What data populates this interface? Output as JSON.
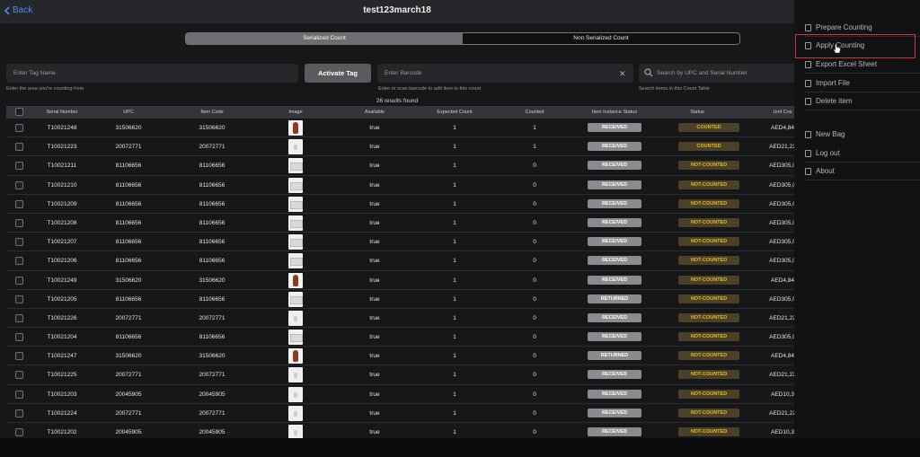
{
  "header": {
    "back_label": "Back",
    "title": "test123march18"
  },
  "segment": {
    "serialized": "Serialized Count",
    "non_serialized": "Non Serialized Count"
  },
  "inputs": {
    "tag_placeholder": "Enter Tag Name",
    "tag_hint": "Enter the area you're counting from.",
    "activate_label": "Activate Tag",
    "barcode_placeholder": "Enter Barcode",
    "barcode_hint": "Enter or scan barcode to add item to this count",
    "search_placeholder": "Search by UPC and Serial Number",
    "search_hint": "Search items in this Count Table"
  },
  "results_label": "26 results found",
  "table": {
    "headers": [
      "Serial Number",
      "UPC",
      "Item Code",
      "Image",
      "Available",
      "Expected Count",
      "Counted",
      "Item Instance Status",
      "Status",
      "Unit Cos"
    ],
    "rows": [
      {
        "serial": "T10021248",
        "upc": "31506620",
        "code": "31506620",
        "img": "vase",
        "available": "true",
        "expected": "1",
        "counted": "1",
        "instance": "RECEIVED",
        "status": "COUNTED",
        "cost": "AED4,84"
      },
      {
        "serial": "T10021223",
        "upc": "20072771",
        "code": "20072771",
        "img": "white",
        "available": "true",
        "expected": "1",
        "counted": "1",
        "instance": "RECEIVED",
        "status": "COUNTED",
        "cost": "AED21,22"
      },
      {
        "serial": "T10021211",
        "upc": "81106656",
        "code": "81106656",
        "img": "box",
        "available": "true",
        "expected": "1",
        "counted": "0",
        "instance": "RECEIVED",
        "status": "NOT-COUNTED",
        "cost": "AED305,0"
      },
      {
        "serial": "T10021210",
        "upc": "81106656",
        "code": "81106656",
        "img": "box",
        "available": "true",
        "expected": "1",
        "counted": "0",
        "instance": "RECEIVED",
        "status": "NOT-COUNTED",
        "cost": "AED305,0"
      },
      {
        "serial": "T10021209",
        "upc": "81106656",
        "code": "81106656",
        "img": "box",
        "available": "true",
        "expected": "1",
        "counted": "0",
        "instance": "RECEIVED",
        "status": "NOT-COUNTED",
        "cost": "AED305,0"
      },
      {
        "serial": "T10021208",
        "upc": "81106656",
        "code": "81106656",
        "img": "box",
        "available": "true",
        "expected": "1",
        "counted": "0",
        "instance": "RECEIVED",
        "status": "NOT-COUNTED",
        "cost": "AED305,0"
      },
      {
        "serial": "T10021207",
        "upc": "81106656",
        "code": "81106656",
        "img": "box",
        "available": "true",
        "expected": "1",
        "counted": "0",
        "instance": "RECEIVED",
        "status": "NOT-COUNTED",
        "cost": "AED305,0"
      },
      {
        "serial": "T10021206",
        "upc": "81106656",
        "code": "81106656",
        "img": "box",
        "available": "true",
        "expected": "1",
        "counted": "0",
        "instance": "RECEIVED",
        "status": "NOT-COUNTED",
        "cost": "AED305,0"
      },
      {
        "serial": "T10021249",
        "upc": "31506620",
        "code": "31506620",
        "img": "vase",
        "available": "true",
        "expected": "1",
        "counted": "0",
        "instance": "RECEIVED",
        "status": "NOT-COUNTED",
        "cost": "AED4,84"
      },
      {
        "serial": "T10021205",
        "upc": "81106656",
        "code": "81106656",
        "img": "box",
        "available": "true",
        "expected": "1",
        "counted": "0",
        "instance": "RETURNED",
        "status": "NOT-COUNTED",
        "cost": "AED305,0"
      },
      {
        "serial": "T10021226",
        "upc": "20072771",
        "code": "20072771",
        "img": "white",
        "available": "true",
        "expected": "1",
        "counted": "0",
        "instance": "RECEIVED",
        "status": "NOT-COUNTED",
        "cost": "AED21,22"
      },
      {
        "serial": "T10021204",
        "upc": "81106656",
        "code": "81106656",
        "img": "box",
        "available": "true",
        "expected": "1",
        "counted": "0",
        "instance": "RECEIVED",
        "status": "NOT-COUNTED",
        "cost": "AED305,0"
      },
      {
        "serial": "T10021247",
        "upc": "31506620",
        "code": "31506620",
        "img": "vase",
        "available": "true",
        "expected": "1",
        "counted": "0",
        "instance": "RETURNED",
        "status": "NOT-COUNTED",
        "cost": "AED4,84"
      },
      {
        "serial": "T10021225",
        "upc": "20072771",
        "code": "20072771",
        "img": "white",
        "available": "true",
        "expected": "1",
        "counted": "0",
        "instance": "RECEIVED",
        "status": "NOT-COUNTED",
        "cost": "AED21,22"
      },
      {
        "serial": "T10021203",
        "upc": "20045905",
        "code": "20045905",
        "img": "white",
        "available": "true",
        "expected": "1",
        "counted": "0",
        "instance": "RECEIVED",
        "status": "NOT-COUNTED",
        "cost": "AED10,3"
      },
      {
        "serial": "T10021224",
        "upc": "20072771",
        "code": "20072771",
        "img": "white",
        "available": "true",
        "expected": "1",
        "counted": "0",
        "instance": "RECEIVED",
        "status": "NOT-COUNTED",
        "cost": "AED21,22"
      },
      {
        "serial": "T10021202",
        "upc": "20045905",
        "code": "20045905",
        "img": "white",
        "available": "true",
        "expected": "1",
        "counted": "0",
        "instance": "RECEIVED",
        "status": "NOT-COUNTED",
        "cost": "AED10,3"
      }
    ]
  },
  "menu": {
    "items": [
      "Prepare Counting",
      "Apply Counting",
      "Export Excel Sheet",
      "Import File",
      "Delete item",
      "New Bag",
      "Log out",
      "About"
    ],
    "icons": [
      "hourglass-icon",
      "apply-icon",
      "export-icon",
      "file-icon",
      "trash-icon",
      "bag-icon",
      "logout-icon",
      "info-icon"
    ]
  },
  "colors": {
    "accent": "#4a90e2",
    "counted": "#e9b821",
    "highlight": "#d9322f"
  }
}
